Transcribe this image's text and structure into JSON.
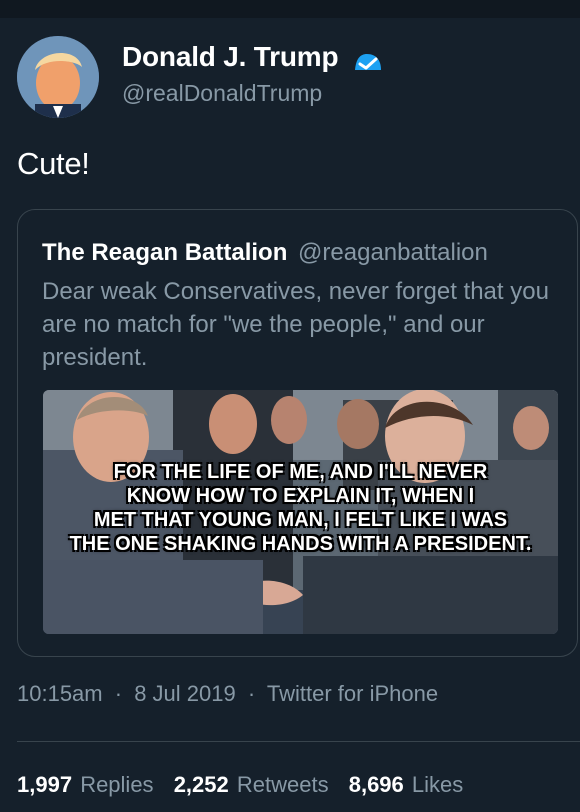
{
  "colors": {
    "background": "#15202b",
    "text_primary": "#ffffff",
    "text_secondary": "#8899a6",
    "border": "#38444d",
    "verified_blue": "#1da1f2"
  },
  "author": {
    "display_name": "Donald J. Trump",
    "handle": "@realDonaldTrump",
    "verified_icon": "verified-badge-icon",
    "avatar_icon": "profile-avatar"
  },
  "tweet": {
    "text": "Cute!"
  },
  "quoted_tweet": {
    "display_name": "The Reagan Battalion",
    "handle": "@reaganbattalion",
    "text": "Dear weak Conservatives, never forget that you are no match for \"we the people,\" and our president.",
    "image": {
      "overlay_lines": [
        "FOR THE LIFE OF ME, AND I'LL NEVER",
        "KNOW HOW TO EXPLAIN IT, WHEN I",
        "MET THAT YOUNG MAN, I FELT LIKE I WAS",
        "THE ONE SHAKING HANDS WITH A PRESIDENT."
      ]
    }
  },
  "meta": {
    "time": "10:15am",
    "separator": "·",
    "date": "8 Jul 2019",
    "source": "Twitter for iPhone"
  },
  "stats": {
    "replies": {
      "count": "1,997",
      "label": "Replies"
    },
    "retweets": {
      "count": "2,252",
      "label": "Retweets"
    },
    "likes": {
      "count": "8,696",
      "label": "Likes"
    }
  }
}
